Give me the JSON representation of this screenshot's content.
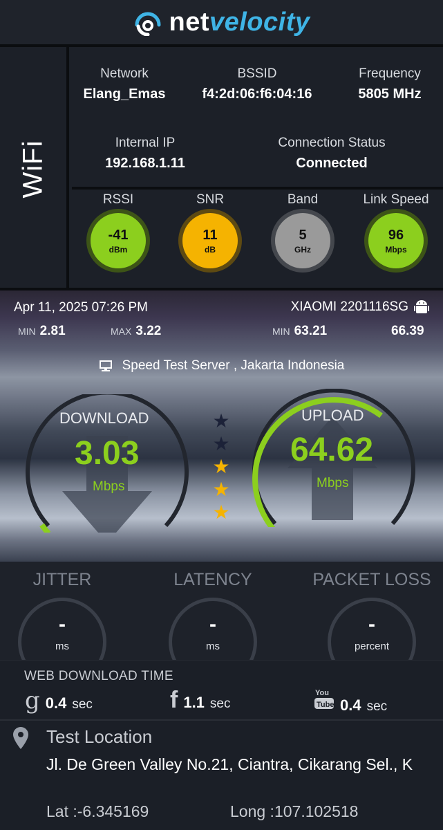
{
  "app": {
    "name_part1": "net",
    "name_part2": "velocity"
  },
  "wifi": {
    "side_label": "WiFi",
    "network": {
      "label": "Network",
      "value": "Elang_Emas"
    },
    "bssid": {
      "label": "BSSID",
      "value": "f4:2d:06:f6:04:16"
    },
    "frequency": {
      "label": "Frequency",
      "value": "5805 MHz"
    },
    "internal_ip": {
      "label": "Internal IP",
      "value": "192.168.1.11"
    },
    "connection_status": {
      "label": "Connection Status",
      "value": "Connected"
    },
    "metrics": [
      {
        "label": "RSSI",
        "value": "-41",
        "unit": "dBm",
        "color": "#8ccf1e"
      },
      {
        "label": "SNR",
        "value": "11",
        "unit": "dB",
        "color": "#f5b301"
      },
      {
        "label": "Band",
        "value": "5",
        "unit": "GHz",
        "color": "#9a9a9a"
      },
      {
        "label": "Link Speed",
        "value": "96",
        "unit": "Mbps",
        "color": "#8ccf1e"
      }
    ]
  },
  "test": {
    "date": "Apr 11, 2025 07:26 PM",
    "device": "XIAOMI 2201116SG",
    "download_min_label": "MIN",
    "download_min": "2.81",
    "download_max_label": "MAX",
    "download_max": "3.22",
    "upload_min_label": "MIN",
    "upload_min": "63.21",
    "upload_max": "66.39",
    "server": "Speed Test Server , Jakarta Indonesia",
    "download": {
      "label": "DOWNLOAD",
      "value": "3.03",
      "unit": "Mbps",
      "fill": 0.03
    },
    "upload": {
      "label": "UPLOAD",
      "value": "64.62",
      "unit": "Mbps",
      "fill": 0.64
    },
    "rating": {
      "filled": 3,
      "total": 5
    }
  },
  "stats": {
    "jitter": {
      "label": "JITTER",
      "value": "-",
      "unit": "ms"
    },
    "latency": {
      "label": "LATENCY",
      "value": "-",
      "unit": "ms"
    },
    "packet_loss": {
      "label": "PACKET LOSS",
      "value": "-",
      "unit": "percent"
    }
  },
  "web_download": {
    "title": "WEB DOWNLOAD TIME",
    "google": {
      "icon": "google-icon",
      "value": "0.4",
      "unit": "sec"
    },
    "facebook": {
      "icon": "facebook-icon",
      "value": "1.1",
      "unit": "sec"
    },
    "youtube": {
      "icon": "youtube-icon",
      "value": "0.4",
      "unit": "sec"
    }
  },
  "location": {
    "title": "Test Location",
    "address": "Jl. De Green Valley No.21, Ciantra, Cikarang Sel., K",
    "lat": "Lat :-6.345169",
    "long": "Long :107.102518"
  },
  "colors": {
    "accent_green": "#8ccf1e",
    "accent_yellow": "#f5b301",
    "brand_blue": "#3fb4e6"
  }
}
